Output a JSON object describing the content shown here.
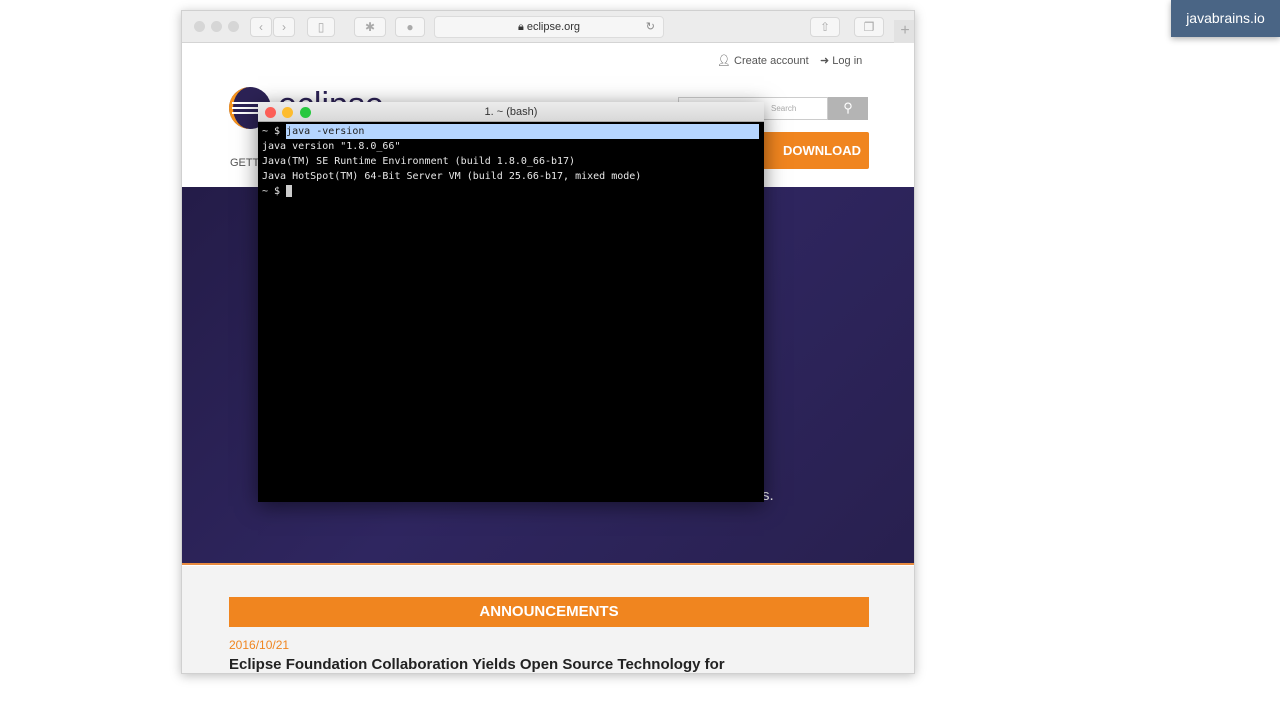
{
  "browser": {
    "url": "eclipse.org",
    "lock_icon": "lock-icon",
    "new_tab": "+"
  },
  "site": {
    "create_account": "Create account",
    "log_in": "Log in",
    "search_placeholder": "Search",
    "search_icon": "search-icon",
    "download": "DOWNLOAD",
    "getting_started": "GETT",
    "hero_text": "Join us.",
    "announcements": "ANNOUNCEMENTS",
    "news_date": "2016/10/21",
    "news_headline": "Eclipse Foundation Collaboration Yields Open Source Technology for"
  },
  "terminal": {
    "title": "1. ~ (bash)",
    "prompt": "~ $ ",
    "command": "java -version",
    "output": [
      "java version \"1.8.0_66\"",
      "Java(TM) SE Runtime Environment (build 1.8.0_66-b17)",
      "Java HotSpot(TM) 64-Bit Server VM (build 25.66-b17, mixed mode)"
    ]
  },
  "watermark": "javabrains.io",
  "colors": {
    "accent": "#f0851f",
    "hero": "#2a2250",
    "badge": "#4a6585"
  }
}
